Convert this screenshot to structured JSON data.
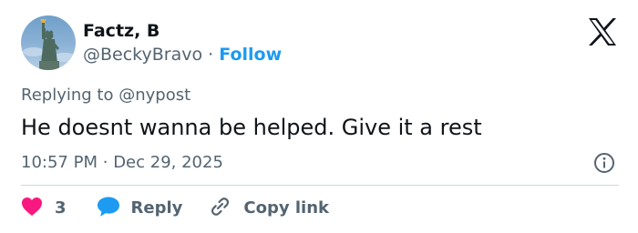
{
  "author": {
    "name": "Factz, B",
    "handle": "@BeckyBravo",
    "separator": "·",
    "follow_label": "Follow"
  },
  "reply_context": {
    "prefix": "Replying to",
    "mention": "@nypost"
  },
  "tweet": {
    "text": "He doesnt wanna be helped. Give it a rest",
    "time": "10:57 PM",
    "separator": "·",
    "date": "Dec 29, 2025"
  },
  "actions": {
    "like_count": "3",
    "reply_label": "Reply",
    "copy_label": "Copy link"
  },
  "colors": {
    "text": "#0f1419",
    "secondary": "#536471",
    "link": "#1d9bf0",
    "heart": "#f91880",
    "reply_bubble": "#1d9bf0",
    "divider": "#cfd9de"
  },
  "icons": {
    "avatar": "statue-of-liberty-avatar",
    "brand": "x-logo-icon",
    "info": "info-icon",
    "like": "heart-icon",
    "reply": "speech-bubble-icon",
    "copy": "link-icon"
  }
}
